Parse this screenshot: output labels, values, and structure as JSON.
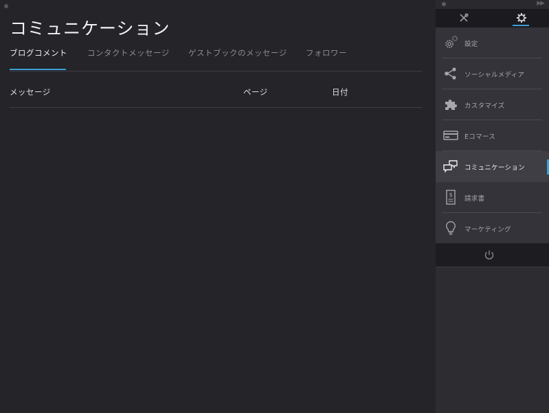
{
  "page": {
    "title": "コミュニケーション"
  },
  "tabs": [
    {
      "label": "ブログコメント",
      "active": true
    },
    {
      "label": "コンタクトメッセージ",
      "active": false
    },
    {
      "label": "ゲストブックのメッセージ",
      "active": false
    },
    {
      "label": "フォロワー",
      "active": false
    }
  ],
  "table": {
    "columns": [
      "メッセージ",
      "ページ",
      "日付"
    ]
  },
  "sidebar": {
    "toolbar": [
      {
        "icon": "tools-icon",
        "active": false
      },
      {
        "icon": "gear-icon",
        "active": true
      }
    ],
    "items": [
      {
        "label": "設定",
        "icon": "settings-gears-icon"
      },
      {
        "label": "ソーシャルメディア",
        "icon": "share-icon"
      },
      {
        "label": "カスタマイズ",
        "icon": "puzzle-icon"
      },
      {
        "label": "Eコマース",
        "icon": "credit-card-icon"
      },
      {
        "label": "コミュニケーション",
        "icon": "chat-bubbles-icon",
        "active": true
      },
      {
        "label": "請求書",
        "icon": "invoice-icon"
      },
      {
        "label": "マーケティング",
        "icon": "lightbulb-icon"
      }
    ],
    "footer": {
      "icon": "power-icon"
    }
  },
  "colors": {
    "accent": "#3aa0d8",
    "background": "#242429",
    "sidebar": "#333339"
  }
}
